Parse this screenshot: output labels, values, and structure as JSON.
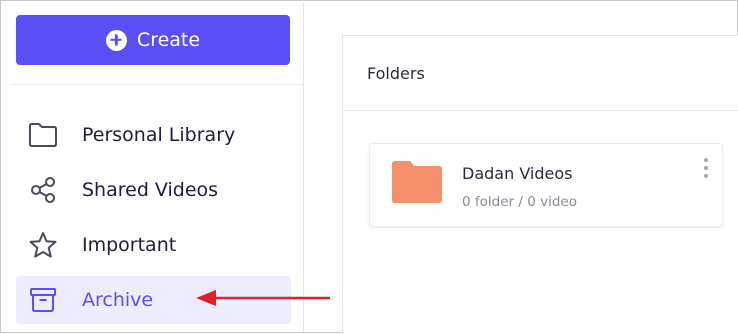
{
  "sidebar": {
    "create_label": "Create",
    "items": [
      {
        "label": "Personal Library",
        "icon": "folder-icon",
        "active": false
      },
      {
        "label": "Shared Videos",
        "icon": "share-icon",
        "active": false
      },
      {
        "label": "Important",
        "icon": "star-icon",
        "active": false
      },
      {
        "label": "Archive",
        "icon": "archive-icon",
        "active": true
      }
    ]
  },
  "main": {
    "section_title": "Folders",
    "folders": [
      {
        "name": "Dadan Videos",
        "meta": "0 folder / 0 video"
      }
    ]
  },
  "colors": {
    "accent": "#5a4ff6",
    "active_bg": "#eeecff",
    "folder": "#f4906a",
    "annotation_arrow": "#e3202a"
  }
}
